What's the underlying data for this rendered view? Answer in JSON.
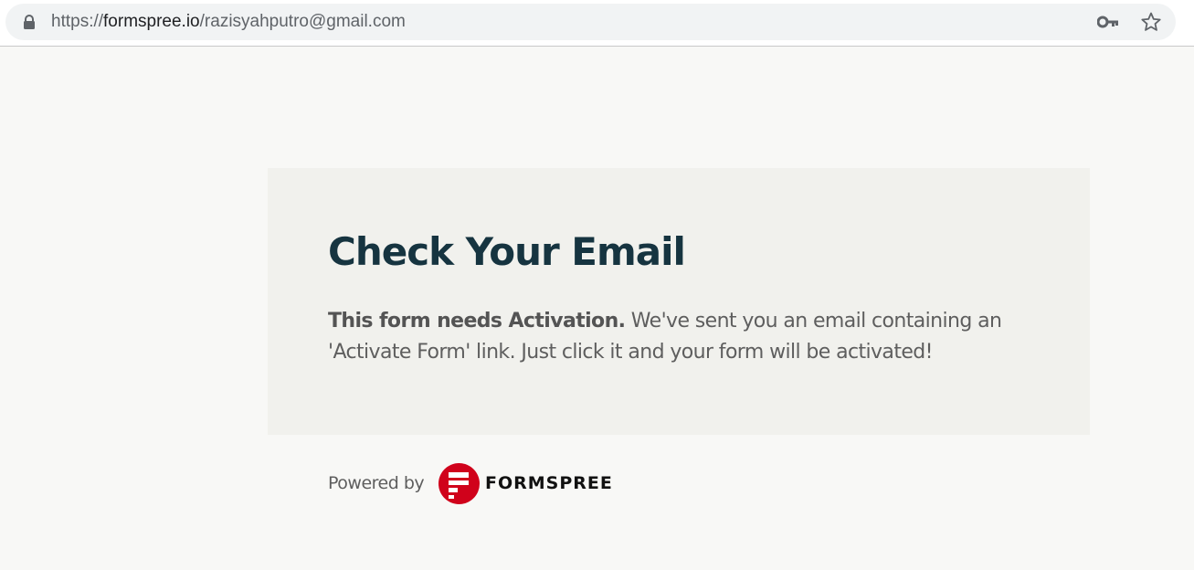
{
  "browser": {
    "url_scheme": "https://",
    "url_host": "formspree.io",
    "url_path": "/razisyahputro@gmail.com",
    "icons": {
      "lock": "lock-icon",
      "key": "key-icon",
      "star": "star-icon"
    }
  },
  "card": {
    "title": "Check Your Email",
    "lead_bold": "This form needs Activation.",
    "body": " We've sent you an email containing an 'Activate Form' link. Just click it and your form will be activated!"
  },
  "footer": {
    "powered_by": "Powered by",
    "brand_name": "FORMSPREE"
  },
  "colors": {
    "page_background": "#f8f8f6",
    "card_background": "#f1f1ed",
    "title": "#163440",
    "body_text": "#5e5e5e",
    "brand_red": "#d0021b"
  }
}
